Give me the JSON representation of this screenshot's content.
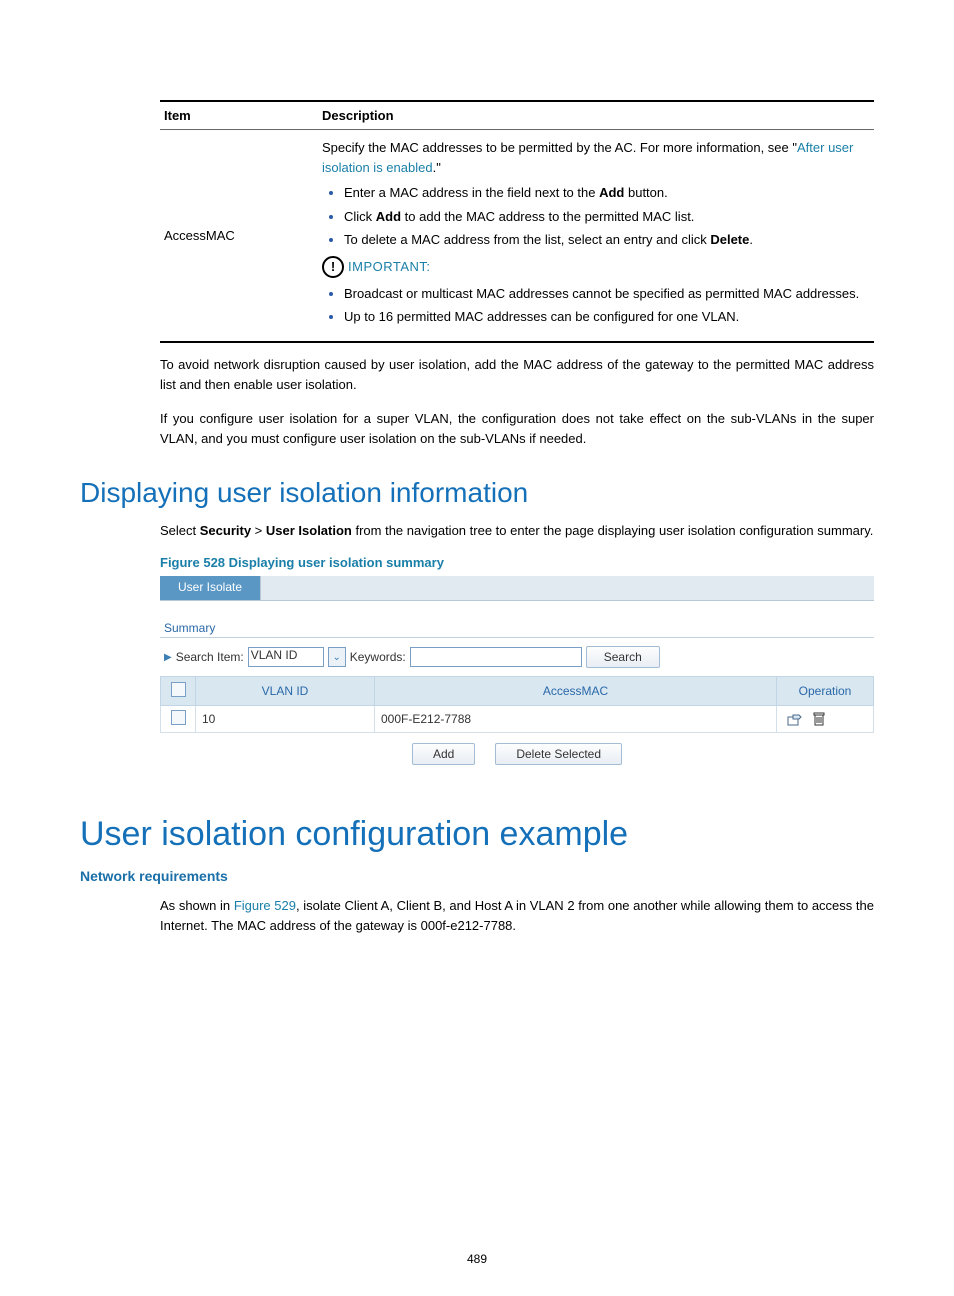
{
  "table": {
    "headers": {
      "item": "Item",
      "desc": "Description"
    },
    "row": {
      "item": "AccessMAC",
      "intro_a": "Specify the MAC addresses to be permitted by the AC. For more information, see \"",
      "intro_link": "After user isolation is enabled",
      "intro_b": ".\"",
      "bul1_a": "Enter a MAC address in the field next to the ",
      "bul1_bold": "Add",
      "bul1_b": " button.",
      "bul2_a": "Click ",
      "bul2_bold": "Add",
      "bul2_b": " to add the MAC address to the permitted MAC list.",
      "bul3_a": "To delete a MAC address from the list, select an entry and click ",
      "bul3_bold": "Delete",
      "bul3_b": ".",
      "important": "IMPORTANT:",
      "imp_bul1": "Broadcast or multicast MAC addresses cannot be specified as permitted MAC addresses.",
      "imp_bul2": "Up to 16 permitted MAC addresses can be configured for one VLAN."
    }
  },
  "para1": "To avoid network disruption caused by user isolation, add the MAC address of the gateway to the permitted MAC address list and then enable user isolation.",
  "para2": "If you configure user isolation for a super VLAN, the configuration does not take effect on the sub-VLANs in the super VLAN, and you must configure user isolation on the sub-VLANs if needed.",
  "h2": "Displaying user isolation information",
  "nav": {
    "pre": "Select ",
    "sec": "Security",
    "gt": " > ",
    "ui": "User Isolation",
    "post": " from the navigation tree to enter the page displaying user isolation configuration summary."
  },
  "figcap": "Figure 528 Displaying user isolation summary",
  "ui": {
    "tab": "User Isolate",
    "summary": "Summary",
    "search_item": "Search Item:",
    "search_sel": "VLAN ID",
    "keywords": "Keywords:",
    "search_btn": "Search",
    "cols": {
      "vlan": "VLAN ID",
      "mac": "AccessMAC",
      "op": "Operation"
    },
    "row": {
      "vlan": "10",
      "mac": "000F-E212-7788"
    },
    "add": "Add",
    "del_sel": "Delete Selected"
  },
  "h1": "User isolation configuration example",
  "h4": "Network requirements",
  "netreq": {
    "a": "As shown in ",
    "link": "Figure 529",
    "b": ", isolate Client A, Client B, and Host A in VLAN 2 from one another while allowing them to access the Internet. The MAC address of the gateway is 000f-e212-7788."
  },
  "pagenum": "489"
}
